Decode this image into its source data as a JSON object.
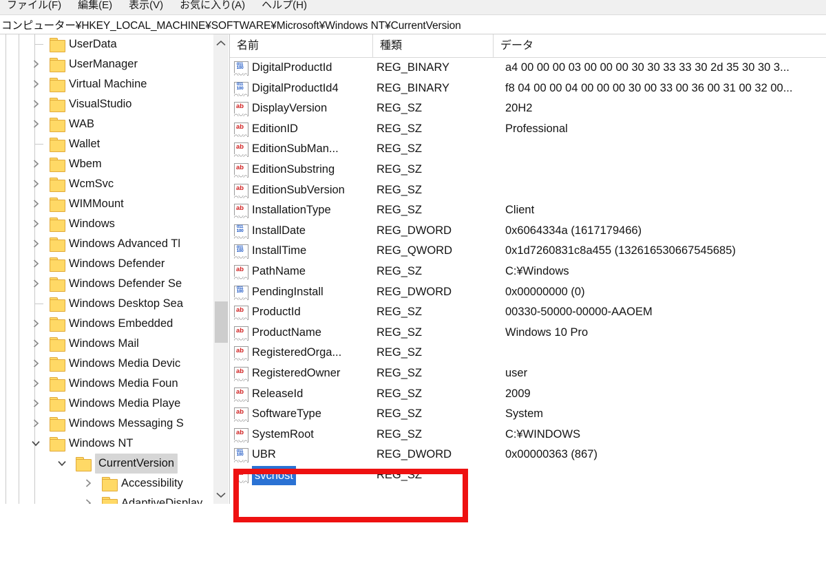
{
  "window": {
    "app": "レジストリ エディター"
  },
  "menubar": {
    "items": [
      {
        "label": "ファイル(F)",
        "name": "menu-file"
      },
      {
        "label": "編集(E)",
        "name": "menu-edit"
      },
      {
        "label": "表示(V)",
        "name": "menu-view"
      },
      {
        "label": "お気に入り(A)",
        "name": "menu-favorites"
      },
      {
        "label": "ヘルプ(H)",
        "name": "menu-help"
      }
    ]
  },
  "address": {
    "path": "コンピューター¥HKEY_LOCAL_MACHINE¥SOFTWARE¥Microsoft¥Windows NT¥CurrentVersion"
  },
  "tree": {
    "items": [
      {
        "label": "UserData",
        "indent": 0,
        "expander": "none",
        "guide": "tee"
      },
      {
        "label": "UserManager",
        "indent": 0,
        "expander": "right",
        "guide": "line"
      },
      {
        "label": "Virtual Machine",
        "indent": 0,
        "expander": "right",
        "guide": "line"
      },
      {
        "label": "VisualStudio",
        "indent": 0,
        "expander": "right",
        "guide": "line"
      },
      {
        "label": "WAB",
        "indent": 0,
        "expander": "right",
        "guide": "line"
      },
      {
        "label": "Wallet",
        "indent": 0,
        "expander": "none",
        "guide": "tee"
      },
      {
        "label": "Wbem",
        "indent": 0,
        "expander": "right",
        "guide": "line"
      },
      {
        "label": "WcmSvc",
        "indent": 0,
        "expander": "right",
        "guide": "line"
      },
      {
        "label": "WIMMount",
        "indent": 0,
        "expander": "right",
        "guide": "line"
      },
      {
        "label": "Windows",
        "indent": 0,
        "expander": "right",
        "guide": "line"
      },
      {
        "label": "Windows Advanced Tl",
        "indent": 0,
        "expander": "right",
        "guide": "line"
      },
      {
        "label": "Windows Defender",
        "indent": 0,
        "expander": "right",
        "guide": "line"
      },
      {
        "label": "Windows Defender Se",
        "indent": 0,
        "expander": "right",
        "guide": "line"
      },
      {
        "label": "Windows Desktop Sea",
        "indent": 0,
        "expander": "none",
        "guide": "tee"
      },
      {
        "label": "Windows Embedded",
        "indent": 0,
        "expander": "right",
        "guide": "line"
      },
      {
        "label": "Windows Mail",
        "indent": 0,
        "expander": "right",
        "guide": "line"
      },
      {
        "label": "Windows Media Devic",
        "indent": 0,
        "expander": "right",
        "guide": "line"
      },
      {
        "label": "Windows Media Foun",
        "indent": 0,
        "expander": "right",
        "guide": "line"
      },
      {
        "label": "Windows Media Playe",
        "indent": 0,
        "expander": "right",
        "guide": "line"
      },
      {
        "label": "Windows Messaging S",
        "indent": 0,
        "expander": "right",
        "guide": "line"
      },
      {
        "label": "Windows NT",
        "indent": 0,
        "expander": "down",
        "guide": "line"
      },
      {
        "label": "CurrentVersion",
        "indent": 1,
        "expander": "down",
        "guide": "none",
        "selected": true
      },
      {
        "label": "Accessibility",
        "indent": 2,
        "expander": "right",
        "guide": "none"
      },
      {
        "label": "AdaptiveDisplay",
        "indent": 2,
        "expander": "right",
        "guide": "none"
      }
    ]
  },
  "list": {
    "columns": [
      {
        "label": "名前"
      },
      {
        "label": "種類"
      },
      {
        "label": "データ"
      }
    ],
    "rows": [
      {
        "name": "DigitalProductId",
        "icontype": "binary",
        "type": "REG_BINARY",
        "data": "a4 00 00 00 03 00 00 00 30 30 33 33 30 2d 35 30 30 3..."
      },
      {
        "name": "DigitalProductId4",
        "icontype": "binary",
        "type": "REG_BINARY",
        "data": "f8 04 00 00 04 00 00 00 30 00 33 00 36 00 31 00 32 00..."
      },
      {
        "name": "DisplayVersion",
        "icontype": "string",
        "type": "REG_SZ",
        "data": "20H2"
      },
      {
        "name": "EditionID",
        "icontype": "string",
        "type": "REG_SZ",
        "data": "Professional"
      },
      {
        "name": "EditionSubMan...",
        "icontype": "string",
        "type": "REG_SZ",
        "data": ""
      },
      {
        "name": "EditionSubstring",
        "icontype": "string",
        "type": "REG_SZ",
        "data": ""
      },
      {
        "name": "EditionSubVersion",
        "icontype": "string",
        "type": "REG_SZ",
        "data": ""
      },
      {
        "name": "InstallationType",
        "icontype": "string",
        "type": "REG_SZ",
        "data": "Client"
      },
      {
        "name": "InstallDate",
        "icontype": "binary",
        "type": "REG_DWORD",
        "data": "0x6064334a (1617179466)"
      },
      {
        "name": "InstallTime",
        "icontype": "binary",
        "type": "REG_QWORD",
        "data": "0x1d7260831c8a455 (132616530667545685)"
      },
      {
        "name": "PathName",
        "icontype": "string",
        "type": "REG_SZ",
        "data": "C:¥Windows"
      },
      {
        "name": "PendingInstall",
        "icontype": "binary",
        "type": "REG_DWORD",
        "data": "0x00000000 (0)"
      },
      {
        "name": "ProductId",
        "icontype": "string",
        "type": "REG_SZ",
        "data": "00330-50000-00000-AAOEM"
      },
      {
        "name": "ProductName",
        "icontype": "string",
        "type": "REG_SZ",
        "data": "Windows 10 Pro"
      },
      {
        "name": "RegisteredOrga...",
        "icontype": "string",
        "type": "REG_SZ",
        "data": ""
      },
      {
        "name": "RegisteredOwner",
        "icontype": "string",
        "type": "REG_SZ",
        "data": "user"
      },
      {
        "name": "ReleaseId",
        "icontype": "string",
        "type": "REG_SZ",
        "data": "2009"
      },
      {
        "name": "SoftwareType",
        "icontype": "string",
        "type": "REG_SZ",
        "data": "System"
      },
      {
        "name": "SystemRoot",
        "icontype": "string",
        "type": "REG_SZ",
        "data": "C:¥WINDOWS"
      },
      {
        "name": "UBR",
        "icontype": "binary",
        "type": "REG_DWORD",
        "data": "0x00000363 (867)"
      },
      {
        "name": "svchost",
        "icontype": "string",
        "type": "REG_SZ",
        "data": "",
        "editing": true
      }
    ]
  },
  "annotation": {
    "color": "#ee1111",
    "target": "svchost"
  },
  "scrollbars": {
    "tree_up": "▲",
    "tree_down": "▼",
    "tree_left": "◀",
    "tree_right": "▶"
  }
}
